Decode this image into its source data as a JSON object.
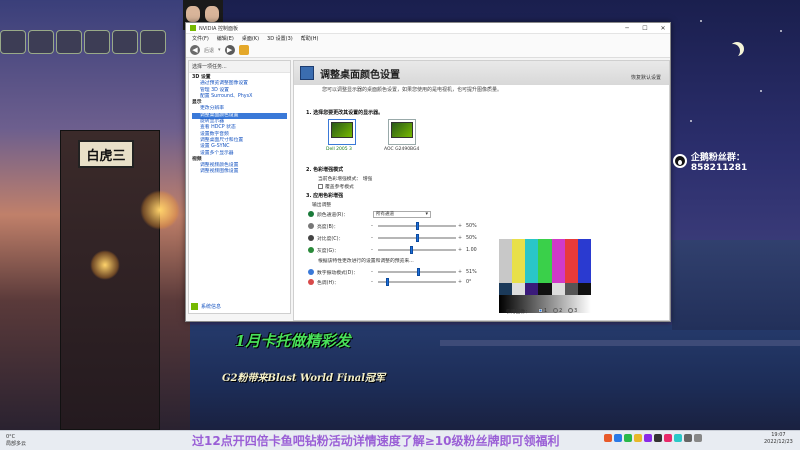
{
  "window": {
    "title": "NVIDIA 控制面板",
    "menu": [
      "文件(F)",
      "编辑(E)",
      "桌面(K)",
      "3D 设置(3)",
      "帮助(H)"
    ],
    "back_label": "后退"
  },
  "left_pane": {
    "header": "选择一项任务...",
    "tree": [
      {
        "label": "3D 设置",
        "type": "cat"
      },
      {
        "label": "通过预览调整图像设置",
        "type": "item"
      },
      {
        "label": "管理 3D 设置",
        "type": "item"
      },
      {
        "label": "配置 Surround、PhysX",
        "type": "item"
      },
      {
        "label": "显示",
        "type": "cat"
      },
      {
        "label": "更改分辨率",
        "type": "item"
      },
      {
        "label": "调整桌面颜色设置",
        "type": "item",
        "selected": true
      },
      {
        "label": "旋转显示器",
        "type": "item"
      },
      {
        "label": "查看 HDCP 状态",
        "type": "item"
      },
      {
        "label": "设置数字音频",
        "type": "item"
      },
      {
        "label": "调整桌面尺寸和位置",
        "type": "item"
      },
      {
        "label": "设置 G-SYNC",
        "type": "item"
      },
      {
        "label": "设置多个显示器",
        "type": "item"
      },
      {
        "label": "视频",
        "type": "cat"
      },
      {
        "label": "调整视频颜色设置",
        "type": "item"
      },
      {
        "label": "调整视频图像设置",
        "type": "item"
      }
    ],
    "system_info": "系统信息"
  },
  "content": {
    "title": "调整桌面颜色设置",
    "restore": "恢复默认设置",
    "intro": "您可以调整显示器的桌面颜色设置，如果您使用的是电视机，也可提升图像质量。",
    "step1": "1. 选择您要更改其设置的显示器。",
    "monitors": [
      {
        "label": "Dell 2005 3",
        "selected": true
      },
      {
        "label": "AOC G2490BG4",
        "selected": false
      }
    ],
    "step2": "2. 色彩增强模式",
    "current_mode": "当前色彩增强模式：  增强",
    "override_label": "覆盖参考模式",
    "step3": "3. 应用色彩增强",
    "output_label": "输出调整",
    "channel_label": "颜色通道(R)：",
    "channel_value": "所有通道",
    "sliders_top": [
      {
        "label": "亮度(B)：",
        "value": "50%",
        "pos": 0.5,
        "color": "#777777"
      },
      {
        "label": "对比度(C)：",
        "value": "50%",
        "pos": 0.5,
        "color": "#444444"
      },
      {
        "label": "灰度(G)：",
        "value": "1.00",
        "pos": 0.42,
        "color": "#2a8a3a"
      }
    ],
    "note": "根据该特性更改进行的设置和调整的预览来...",
    "sliders_bottom": [
      {
        "label": "数字振动模式(D)：",
        "value": "51%",
        "pos": 0.51,
        "color": "#3a79d8"
      },
      {
        "label": "色调(H)：",
        "value": "0°",
        "pos": 0.12,
        "color": "#d84a4a"
      }
    ],
    "ref_label": "引用图像：",
    "ref_options": [
      "1",
      "2",
      "3"
    ],
    "ref_selected": 0,
    "test_colors": [
      "#c8c8c8",
      "#e8e04a",
      "#2ac6c8",
      "#3ad04a",
      "#d03ac8",
      "#e83a3a",
      "#2a3ad0"
    ]
  },
  "overlay": {
    "fan_group": "企鹅粉丝群：858211281",
    "promo1": "1月卡托做精彩发",
    "promo2": "G2粉带来Blast World Final冠军",
    "ticker": "过12点开四倍卡鱼吧钻粉活动详情速度了解≥10级粉丝牌即可领福利",
    "shop_sign": "白虎三"
  },
  "taskbar": {
    "weather_temp": "0°C",
    "weather_desc": "局部多云",
    "time": "19:07",
    "date": "2022/12/23"
  }
}
